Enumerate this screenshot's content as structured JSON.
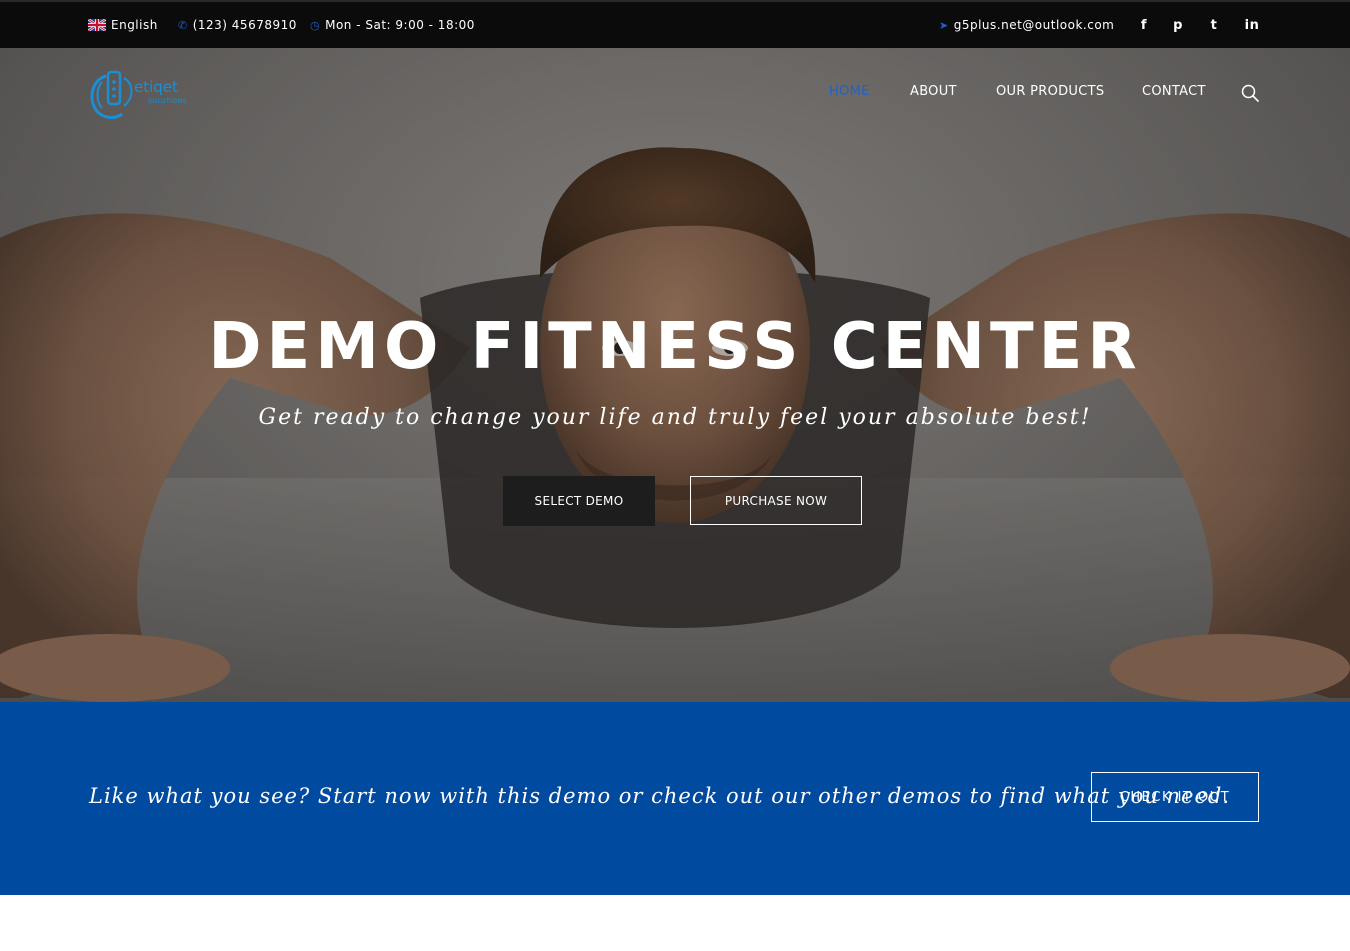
{
  "topbar": {
    "language": "English",
    "phone": "(123) 45678910",
    "hours": "Mon - Sat: 9:00 - 18:00",
    "email": "g5plus.net@outlook.com",
    "social": [
      "f",
      "p",
      "t",
      "in"
    ]
  },
  "logo": {
    "name": "etiqet",
    "tagline": "SOLUTIONS"
  },
  "nav": {
    "items": [
      "HOME",
      "ABOUT",
      "OUR PRODUCTS",
      "CONTACT"
    ],
    "active": "HOME"
  },
  "hero": {
    "title": "DEMO FITNESS CENTER",
    "subtitle": "Get ready to change your life and truly feel your absolute best!",
    "primary_button": "SELECT DEMO",
    "secondary_button": "PURCHASE NOW"
  },
  "cta": {
    "text": "Like what you see? Start now with this demo or check out our other demos to find what you need.",
    "button": "CHECK IT OUT"
  },
  "colors": {
    "accent": "#1e63c9",
    "cta_background": "#004a9f",
    "topbar_background": "#0b0b0b"
  }
}
